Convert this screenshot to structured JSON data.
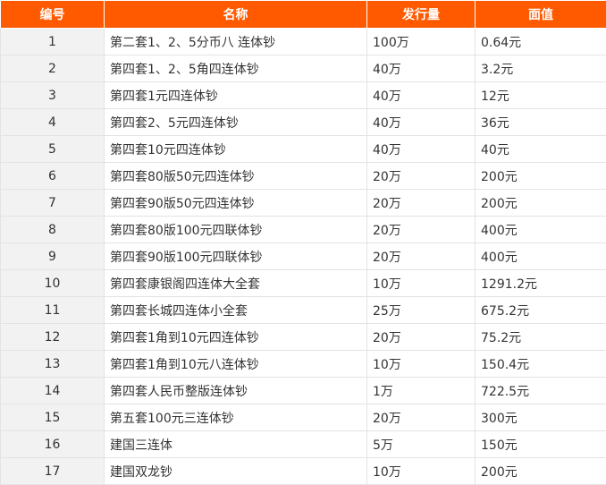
{
  "headers": [
    "编号",
    "名称",
    "发行量",
    "面值"
  ],
  "rows": [
    [
      "1",
      "第二套1、2、5分币八 连体钞",
      "100万",
      "0.64元"
    ],
    [
      "2",
      "第四套1、2、5角四连体钞",
      "40万",
      "3.2元"
    ],
    [
      "3",
      "第四套1元四连体钞",
      "40万",
      "12元"
    ],
    [
      "4",
      "第四套2、5元四连体钞",
      "40万",
      "36元"
    ],
    [
      "5",
      "第四套10元四连体钞",
      "40万",
      "40元"
    ],
    [
      "6",
      "第四套80版50元四连体钞",
      "20万",
      "200元"
    ],
    [
      "7",
      "第四套90版50元四连体钞",
      "20万",
      "200元"
    ],
    [
      "8",
      "第四套80版100元四联体钞",
      "20万",
      "400元"
    ],
    [
      "9",
      "第四套90版100元四联体钞",
      "20万",
      "400元"
    ],
    [
      "10",
      "第四套康银阁四连体大全套",
      "10万",
      "1291.2元"
    ],
    [
      "11",
      "第四套长城四连体小全套",
      "25万",
      "675.2元"
    ],
    [
      "12",
      "第四套1角到10元四连体钞",
      "20万",
      "75.2元"
    ],
    [
      "13",
      "第四套1角到10元八连体钞",
      "10万",
      "150.4元"
    ],
    [
      "14",
      "第四套人民币整版连体钞",
      "1万",
      "722.5元"
    ],
    [
      "15",
      "第五套100元三连体钞",
      "20万",
      "300元"
    ],
    [
      "16",
      "建国三连体",
      "5万",
      "150元"
    ],
    [
      "17",
      "建国双龙钞",
      "10万",
      "200元"
    ]
  ]
}
